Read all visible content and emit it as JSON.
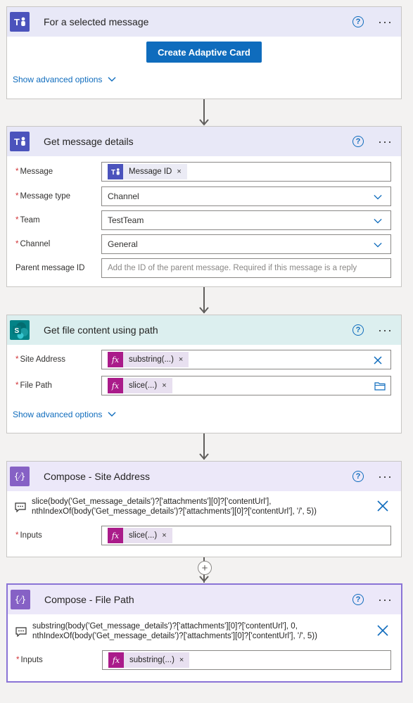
{
  "cards": {
    "selected_message": {
      "title": "For a selected message",
      "create_card_button": "Create Adaptive Card",
      "advanced_options": "Show advanced options"
    },
    "get_message_details": {
      "title": "Get message details",
      "fields": {
        "message": {
          "label": "Message",
          "token": "Message ID"
        },
        "message_type": {
          "label": "Message type",
          "value": "Channel"
        },
        "team": {
          "label": "Team",
          "value": "TestTeam"
        },
        "channel": {
          "label": "Channel",
          "value": "General"
        },
        "parent_message_id": {
          "label": "Parent message ID",
          "placeholder": "Add the ID of the parent message. Required if this message is a reply"
        }
      }
    },
    "get_file_content": {
      "title": "Get file content using path",
      "fields": {
        "site_address": {
          "label": "Site Address",
          "token": "substring(...)"
        },
        "file_path": {
          "label": "File Path",
          "token": "slice(...)"
        }
      },
      "advanced_options": "Show advanced options"
    },
    "compose_site_address": {
      "title": "Compose - Site Address",
      "expression_line1": "slice(body('Get_message_details')?['attachments'][0]?['contentUrl'],",
      "expression_line2": "nthIndexOf(body('Get_message_details')?['attachments'][0]?['contentUrl'], '/', 5))",
      "inputs_label": "Inputs",
      "inputs_token": "slice(...)"
    },
    "compose_file_path": {
      "title": "Compose - File Path",
      "expression_line1": "substring(body('Get_message_details')?['attachments'][0]?['contentUrl'], 0,",
      "expression_line2": "nthIndexOf(body('Get_message_details')?['attachments'][0]?['contentUrl'], '/', 5))",
      "inputs_label": "Inputs",
      "inputs_token": "substring(...)"
    }
  },
  "common": {
    "help_glyph": "?",
    "more_glyph": "···",
    "required_marker": "*",
    "token_remove": "×",
    "fx_glyph": "fx",
    "compose_glyph": "{⁄}",
    "add_step_glyph": "+"
  },
  "colors": {
    "accent": "#0f6cbd",
    "teams": "#4b53bc",
    "sharepoint": "#038387",
    "compose": "#8661c5",
    "expression_token": "#aa1b8a",
    "required": "#d13438",
    "selected_border": "#8a74d6"
  },
  "icons": {
    "teams": "teams-icon",
    "sharepoint": "sharepoint-icon",
    "compose": "compose-icon",
    "help": "help-icon",
    "more": "more-icon",
    "chevron": "chevron-down-icon",
    "folder": "folder-icon",
    "clear": "clear-icon",
    "comment": "comment-icon"
  }
}
